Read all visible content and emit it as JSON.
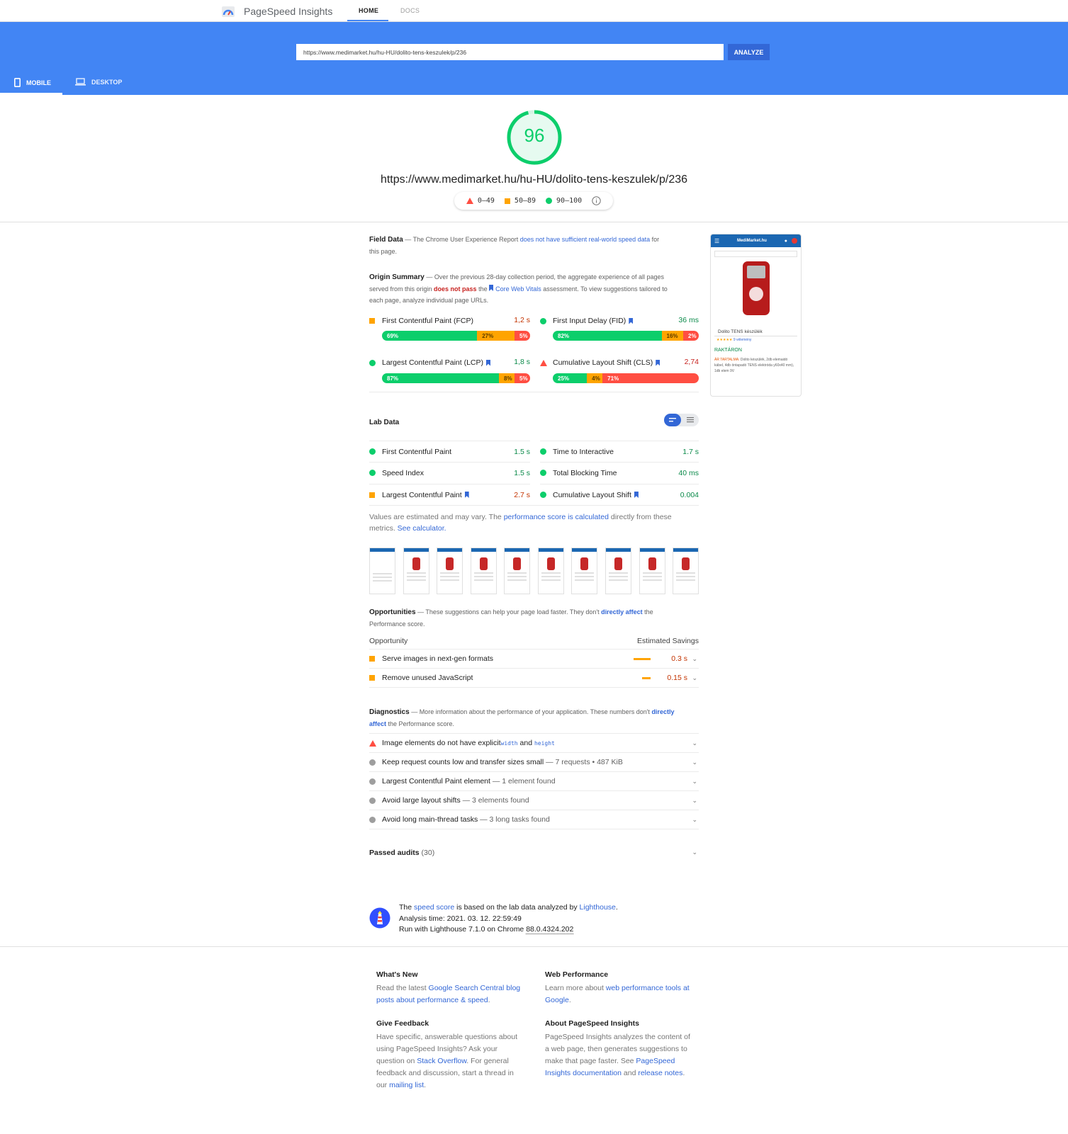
{
  "header": {
    "app_title": "PageSpeed Insights",
    "nav_home": "HOME",
    "nav_docs": "DOCS"
  },
  "search": {
    "url_value": "https://www.medimarket.hu/hu-HU/dolito-tens-keszulek/p/236",
    "analyze_label": "ANALYZE"
  },
  "device_tabs": {
    "mobile": "MOBILE",
    "desktop": "DESKTOP"
  },
  "score": {
    "value": "96",
    "fraction": 0.96,
    "tested_url": "https://www.medimarket.hu/hu-HU/dolito-tens-keszulek/p/236",
    "legend": [
      "0–49",
      "50–89",
      "90–100"
    ]
  },
  "field_data": {
    "title": "Field Data",
    "text_a": " — The Chrome User Experience Report ",
    "link": "does not have sufficient real-world speed data",
    "text_b": " for this page."
  },
  "origin_summary": {
    "title": "Origin Summary",
    "text_a": " — Over the previous 28-day collection period, the aggregate experience of all pages served from this origin ",
    "fail": "does not pass",
    "text_b": " the ",
    "link": "Core Web Vitals",
    "text_c": " assessment. To view suggestions tailored to each page, analyze individual page URLs.",
    "metrics": [
      {
        "label": "First Contentful Paint (FCP)",
        "value": "1,2 s",
        "dist": [
          69,
          27,
          5
        ],
        "dist_labels": [
          "69%",
          "27%",
          "5%"
        ]
      },
      {
        "label": "First Input Delay (FID)",
        "value": "36 ms",
        "dist": [
          82,
          16,
          2
        ],
        "dist_labels": [
          "82%",
          "16%",
          "2%"
        ]
      },
      {
        "label": "Largest Contentful Paint (LCP)",
        "value": "1,8 s",
        "dist": [
          87,
          8,
          5
        ],
        "dist_labels": [
          "87%",
          "8%",
          "5%"
        ]
      },
      {
        "label": "Cumulative Layout Shift (CLS)",
        "value": "2,74",
        "dist": [
          25,
          4,
          71
        ],
        "dist_labels": [
          "25%",
          "4%",
          "71%"
        ]
      }
    ]
  },
  "lab_data": {
    "title": "Lab Data",
    "metrics": [
      {
        "label": "First Contentful Paint",
        "value": "1.5 s"
      },
      {
        "label": "Time to Interactive",
        "value": "1.7 s"
      },
      {
        "label": "Speed Index",
        "value": "1.5 s"
      },
      {
        "label": "Total Blocking Time",
        "value": "40 ms"
      },
      {
        "label": "Largest Contentful Paint",
        "value": "2.7 s"
      },
      {
        "label": "Cumulative Layout Shift",
        "value": "0.004"
      }
    ],
    "note_a": "Values are estimated and may vary. The ",
    "note_link": "performance score is calculated",
    "note_b": " directly from these metrics. ",
    "note_calc": "See calculator."
  },
  "opportunities": {
    "title": "Opportunities",
    "text_a": " — These suggestions can help your page load faster. They don't ",
    "link": "directly affect",
    "text_b": " the Performance score.",
    "col_opportunity": "Opportunity",
    "col_savings": "Estimated Savings",
    "items": [
      {
        "label": "Serve images in next-gen formats",
        "savings": "0.3 s"
      },
      {
        "label": "Remove unused JavaScript",
        "savings": "0.15 s"
      }
    ]
  },
  "diagnostics": {
    "title": "Diagnostics",
    "text_a": " — More information about the performance of your application. These numbers don't ",
    "link": "directly affect",
    "text_b": " the Performance score.",
    "items": [
      {
        "label": "Image elements do not have explicit ",
        "code1": "width",
        "mid": " and ",
        "code2": "height",
        "detail": ""
      },
      {
        "label": "Keep request counts low and transfer sizes small",
        "detail": " — 7 requests • 487 KiB"
      },
      {
        "label": "Largest Contentful Paint element",
        "detail": " — 1 element found"
      },
      {
        "label": "Avoid large layout shifts",
        "detail": " — 3 elements found"
      },
      {
        "label": "Avoid long main-thread tasks",
        "detail": " — 3 long tasks found"
      }
    ]
  },
  "passed": {
    "label": "Passed audits",
    "count": "(30)"
  },
  "lighthouse": {
    "line1_a": "The ",
    "line1_link": "speed score",
    "line1_b": " is based on the lab data analyzed by ",
    "line1_link2": "Lighthouse",
    "line1_c": ".",
    "line2": "Analysis time: 2021. 03. 12. 22:59:49",
    "line3_a": "Run with Lighthouse 7.1.0 on Chrome ",
    "line3_ver": "88.0.4324.202"
  },
  "screenshot_preview": {
    "site_name": "MediMarket.hu",
    "product": "Dolito TENS készülék",
    "reviews": "9 vélemény",
    "stock": "RAKTÁRON",
    "contents_label": "ÁR TARTALMA:",
    "contents": "Dolito készülék, 2db elemaidó kábel, 4db öntapadó TENS elektróda y60x40 mm), 1db elem 9V"
  },
  "footer": {
    "whats_new_title": "What's New",
    "whats_new_a": "Read the latest ",
    "whats_new_link": "Google Search Central blog posts about performance & speed",
    "whats_new_b": ".",
    "webperf_title": "Web Performance",
    "webperf_a": "Learn more about ",
    "webperf_link": "web performance tools at Google",
    "webperf_b": ".",
    "feedback_title": "Give Feedback",
    "feedback_a": "Have specific, answerable questions about using PageSpeed Insights? Ask your question on ",
    "feedback_link": "Stack Overflow",
    "feedback_b": ". For general feedback and discussion, start a thread in our ",
    "feedback_link2": "mailing list",
    "feedback_c": ".",
    "about_title": "About PageSpeed Insights",
    "about_a": "PageSpeed Insights analyzes the content of a web page, then generates suggestions to make that page faster. See ",
    "about_link": "PageSpeed Insights documentation",
    "about_b": " and ",
    "about_link2": "release notes",
    "about_c": "."
  },
  "colors": {
    "blue": "#4285f4",
    "pass": "#0cce6b",
    "average": "#ffa400",
    "fail": "#ff4e42"
  }
}
